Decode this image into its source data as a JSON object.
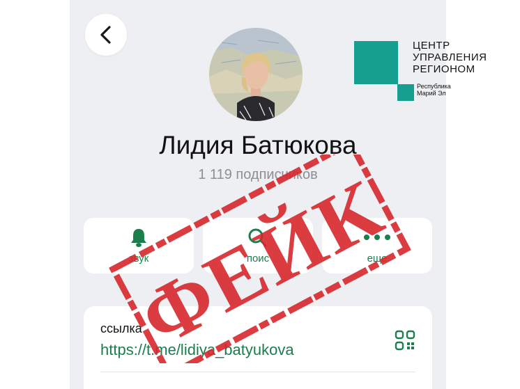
{
  "profile": {
    "name": "Лидия Батюкова",
    "subscribers": "1 119 подписчиков"
  },
  "actions": [
    {
      "label": "звук",
      "icon": "bell-icon"
    },
    {
      "label": "поис",
      "icon": "search-icon"
    },
    {
      "label": "еще",
      "icon": "more-icon"
    }
  ],
  "info": {
    "link_title": "ссылка",
    "link_url": "https://t.me/lidiya_batyukova"
  },
  "stamp": {
    "text": "ФЕЙК"
  },
  "logo": {
    "line1": "ЦЕНТР",
    "line2": "УПРАВЛЕНИЯ",
    "line3": "РЕГИОНОМ",
    "sub1": "Республика",
    "sub2": "Марий Эл"
  },
  "colors": {
    "accent": "#1c7d4d",
    "stamp": "#d6272c",
    "logo": "#169f8f",
    "background": "#eeeff2"
  }
}
